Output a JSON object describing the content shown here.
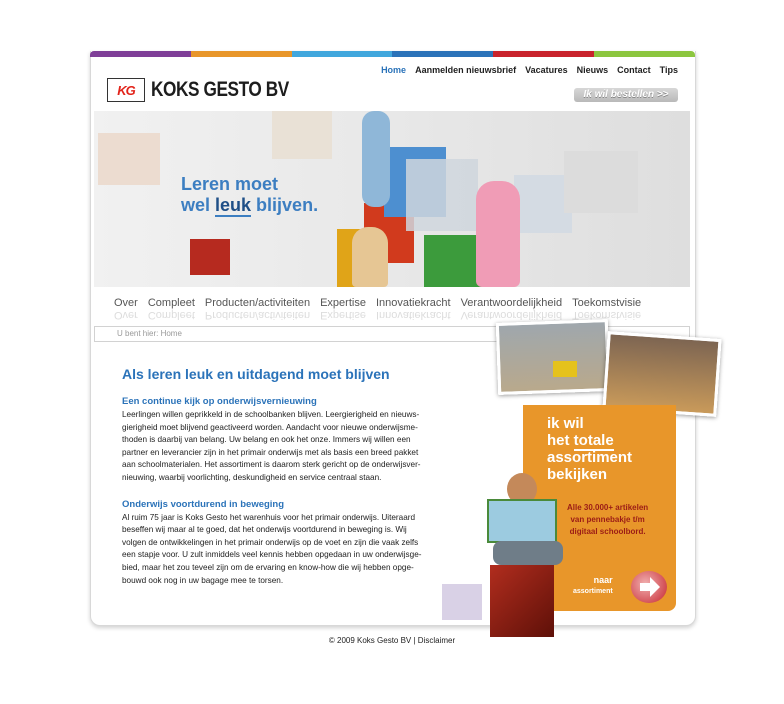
{
  "colors": {
    "bar": [
      "#7f3f98",
      "#e8962a",
      "#41a7dd",
      "#2b73b9",
      "#c9232c",
      "#8cc63f"
    ],
    "accent": "#2b73b9",
    "orange_panel": "#e8962a"
  },
  "brand": {
    "mark": "KG",
    "name": "KOKS GESTO BV"
  },
  "topnav": [
    {
      "label": "Home",
      "active": true
    },
    {
      "label": "Aanmelden nieuwsbrief"
    },
    {
      "label": "Vacatures"
    },
    {
      "label": "Nieuws"
    },
    {
      "label": "Contact"
    },
    {
      "label": "Tips"
    }
  ],
  "order_button": "Ik wil bestellen >>",
  "hero": {
    "line1": "Leren moet",
    "line2_a": "wel ",
    "line2_b": "leuk",
    "line2_c": " blijven."
  },
  "mainnav": [
    "Over",
    "Compleet",
    "Producten/activiteiten",
    "Expertise",
    "Innovatiekracht",
    "Verantwoordelijkheid",
    "Toekomstvisie"
  ],
  "breadcrumb": "U bent hier: Home",
  "content": {
    "title": "Als leren leuk en uitdagend moet blijven",
    "section1_heading": "Een continue kijk op onderwijsvernieuwing",
    "section1_lines": [
      "Leerlingen willen geprikkeld in de schoolbanken blijven. Leergierigheid en nieuws-",
      "gierigheid moet blijvend geactiveerd worden. Aandacht voor nieuwe onderwijsme-",
      "thoden is daarbij van belang. Uw belang en ook het onze. Immers wij willen een",
      "partner en leverancier zijn in het primair onderwijs met als basis een breed pakket",
      "aan schoolmaterialen. Het assortiment is daarom sterk gericht op de onderwijsver-",
      "nieuwing, waarbij voorlichting, deskundigheid en service centraal staan."
    ],
    "section2_heading": "Onderwijs voortdurend in beweging",
    "section2_lines": [
      "Al ruim 75 jaar is Koks Gesto het warenhuis voor het primair onderwijs. Uiteraard",
      "beseffen wij maar al te goed, dat het onderwijs voortdurend in beweging is. Wij",
      "volgen de ontwikkelingen in het primair onderwijs op de voet en zijn die vaak zelfs",
      "een stapje voor. U zult inmiddels veel kennis hebben opgedaan in uw onderwijsge-",
      "bied, maar het zou teveel zijn om de ervaring en know-how die wij hebben opge-",
      "bouwd ook nog in uw bagage mee te torsen."
    ]
  },
  "promo": {
    "line1": "ik wil",
    "line2_a": "het ",
    "line2_b": "totale",
    "line3": "assortiment",
    "line4": "bekijken",
    "sub1": "Alle 30.000+ artikelen",
    "sub2": "van pennebakje t/m",
    "sub3": "digitaal schoolbord.",
    "cta1": "naar",
    "cta2": "assortiment"
  },
  "footer": "© 2009 Koks Gesto BV | Disclaimer"
}
